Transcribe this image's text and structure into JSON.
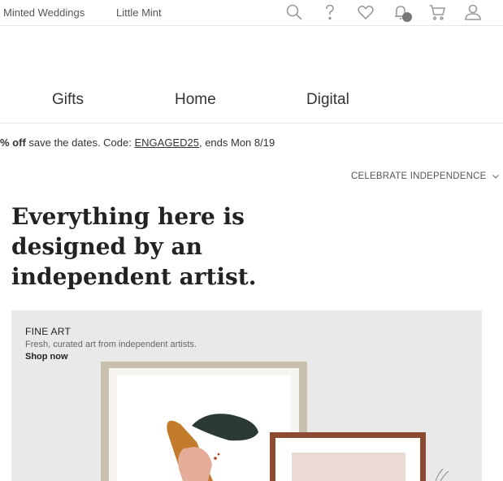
{
  "topbar": {
    "links": [
      {
        "label": "Minted Weddings"
      },
      {
        "label": "Little Mint"
      }
    ],
    "icons": [
      "search-icon",
      "help-icon",
      "heart-icon",
      "bell-icon",
      "cart-icon",
      "account-icon"
    ]
  },
  "nav": {
    "items": [
      {
        "label": "Gifts"
      },
      {
        "label": "Home"
      },
      {
        "label": "Digital"
      }
    ]
  },
  "promo": {
    "discount": "% off",
    "text": " save the dates. Code: ",
    "code": "ENGAGED25",
    "ends": ", ends Mon 8/19"
  },
  "celebrate": {
    "label": "CELEBRATE INDEPENDENCE",
    "icon": "chevron-down-icon"
  },
  "hero": {
    "headline": "Everything here is designed by an independent artist."
  },
  "banner": {
    "kicker": "FINE ART",
    "subtitle": "Fresh, curated art from independent artists.",
    "cta": "Shop now",
    "colors": {
      "background": "#e9e9e9",
      "frame_wood": "#c9bfae",
      "frame_walnut": "#8a4b32"
    }
  }
}
